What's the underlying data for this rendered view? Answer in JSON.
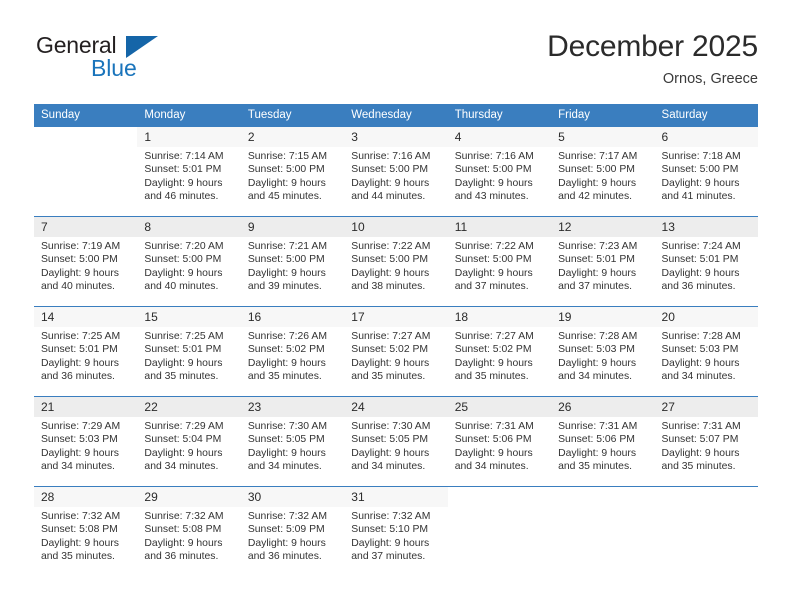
{
  "brand": {
    "name_part1": "General",
    "name_part2": "Blue",
    "accent_color": "#1a74bb",
    "triangle_color": "#1565a8",
    "logo_icon": "blue-triangle-icon"
  },
  "header": {
    "title": "December 2025",
    "subtitle": "Ornos, Greece"
  },
  "calendar": {
    "header_bg": "#3a7ebf",
    "weekday_headers": [
      "Sunday",
      "Monday",
      "Tuesday",
      "Wednesday",
      "Thursday",
      "Friday",
      "Saturday"
    ],
    "weeks": [
      [
        {
          "day": ""
        },
        {
          "day": "1",
          "sunrise": "Sunrise: 7:14 AM",
          "sunset": "Sunset: 5:01 PM",
          "daylight1": "Daylight: 9 hours",
          "daylight2": "and 46 minutes."
        },
        {
          "day": "2",
          "sunrise": "Sunrise: 7:15 AM",
          "sunset": "Sunset: 5:00 PM",
          "daylight1": "Daylight: 9 hours",
          "daylight2": "and 45 minutes."
        },
        {
          "day": "3",
          "sunrise": "Sunrise: 7:16 AM",
          "sunset": "Sunset: 5:00 PM",
          "daylight1": "Daylight: 9 hours",
          "daylight2": "and 44 minutes."
        },
        {
          "day": "4",
          "sunrise": "Sunrise: 7:16 AM",
          "sunset": "Sunset: 5:00 PM",
          "daylight1": "Daylight: 9 hours",
          "daylight2": "and 43 minutes."
        },
        {
          "day": "5",
          "sunrise": "Sunrise: 7:17 AM",
          "sunset": "Sunset: 5:00 PM",
          "daylight1": "Daylight: 9 hours",
          "daylight2": "and 42 minutes."
        },
        {
          "day": "6",
          "sunrise": "Sunrise: 7:18 AM",
          "sunset": "Sunset: 5:00 PM",
          "daylight1": "Daylight: 9 hours",
          "daylight2": "and 41 minutes."
        }
      ],
      [
        {
          "day": "7",
          "sunrise": "Sunrise: 7:19 AM",
          "sunset": "Sunset: 5:00 PM",
          "daylight1": "Daylight: 9 hours",
          "daylight2": "and 40 minutes."
        },
        {
          "day": "8",
          "sunrise": "Sunrise: 7:20 AM",
          "sunset": "Sunset: 5:00 PM",
          "daylight1": "Daylight: 9 hours",
          "daylight2": "and 40 minutes."
        },
        {
          "day": "9",
          "sunrise": "Sunrise: 7:21 AM",
          "sunset": "Sunset: 5:00 PM",
          "daylight1": "Daylight: 9 hours",
          "daylight2": "and 39 minutes."
        },
        {
          "day": "10",
          "sunrise": "Sunrise: 7:22 AM",
          "sunset": "Sunset: 5:00 PM",
          "daylight1": "Daylight: 9 hours",
          "daylight2": "and 38 minutes."
        },
        {
          "day": "11",
          "sunrise": "Sunrise: 7:22 AM",
          "sunset": "Sunset: 5:00 PM",
          "daylight1": "Daylight: 9 hours",
          "daylight2": "and 37 minutes."
        },
        {
          "day": "12",
          "sunrise": "Sunrise: 7:23 AM",
          "sunset": "Sunset: 5:01 PM",
          "daylight1": "Daylight: 9 hours",
          "daylight2": "and 37 minutes."
        },
        {
          "day": "13",
          "sunrise": "Sunrise: 7:24 AM",
          "sunset": "Sunset: 5:01 PM",
          "daylight1": "Daylight: 9 hours",
          "daylight2": "and 36 minutes."
        }
      ],
      [
        {
          "day": "14",
          "sunrise": "Sunrise: 7:25 AM",
          "sunset": "Sunset: 5:01 PM",
          "daylight1": "Daylight: 9 hours",
          "daylight2": "and 36 minutes."
        },
        {
          "day": "15",
          "sunrise": "Sunrise: 7:25 AM",
          "sunset": "Sunset: 5:01 PM",
          "daylight1": "Daylight: 9 hours",
          "daylight2": "and 35 minutes."
        },
        {
          "day": "16",
          "sunrise": "Sunrise: 7:26 AM",
          "sunset": "Sunset: 5:02 PM",
          "daylight1": "Daylight: 9 hours",
          "daylight2": "and 35 minutes."
        },
        {
          "day": "17",
          "sunrise": "Sunrise: 7:27 AM",
          "sunset": "Sunset: 5:02 PM",
          "daylight1": "Daylight: 9 hours",
          "daylight2": "and 35 minutes."
        },
        {
          "day": "18",
          "sunrise": "Sunrise: 7:27 AM",
          "sunset": "Sunset: 5:02 PM",
          "daylight1": "Daylight: 9 hours",
          "daylight2": "and 35 minutes."
        },
        {
          "day": "19",
          "sunrise": "Sunrise: 7:28 AM",
          "sunset": "Sunset: 5:03 PM",
          "daylight1": "Daylight: 9 hours",
          "daylight2": "and 34 minutes."
        },
        {
          "day": "20",
          "sunrise": "Sunrise: 7:28 AM",
          "sunset": "Sunset: 5:03 PM",
          "daylight1": "Daylight: 9 hours",
          "daylight2": "and 34 minutes."
        }
      ],
      [
        {
          "day": "21",
          "sunrise": "Sunrise: 7:29 AM",
          "sunset": "Sunset: 5:03 PM",
          "daylight1": "Daylight: 9 hours",
          "daylight2": "and 34 minutes."
        },
        {
          "day": "22",
          "sunrise": "Sunrise: 7:29 AM",
          "sunset": "Sunset: 5:04 PM",
          "daylight1": "Daylight: 9 hours",
          "daylight2": "and 34 minutes."
        },
        {
          "day": "23",
          "sunrise": "Sunrise: 7:30 AM",
          "sunset": "Sunset: 5:05 PM",
          "daylight1": "Daylight: 9 hours",
          "daylight2": "and 34 minutes."
        },
        {
          "day": "24",
          "sunrise": "Sunrise: 7:30 AM",
          "sunset": "Sunset: 5:05 PM",
          "daylight1": "Daylight: 9 hours",
          "daylight2": "and 34 minutes."
        },
        {
          "day": "25",
          "sunrise": "Sunrise: 7:31 AM",
          "sunset": "Sunset: 5:06 PM",
          "daylight1": "Daylight: 9 hours",
          "daylight2": "and 34 minutes."
        },
        {
          "day": "26",
          "sunrise": "Sunrise: 7:31 AM",
          "sunset": "Sunset: 5:06 PM",
          "daylight1": "Daylight: 9 hours",
          "daylight2": "and 35 minutes."
        },
        {
          "day": "27",
          "sunrise": "Sunrise: 7:31 AM",
          "sunset": "Sunset: 5:07 PM",
          "daylight1": "Daylight: 9 hours",
          "daylight2": "and 35 minutes."
        }
      ],
      [
        {
          "day": "28",
          "sunrise": "Sunrise: 7:32 AM",
          "sunset": "Sunset: 5:08 PM",
          "daylight1": "Daylight: 9 hours",
          "daylight2": "and 35 minutes."
        },
        {
          "day": "29",
          "sunrise": "Sunrise: 7:32 AM",
          "sunset": "Sunset: 5:08 PM",
          "daylight1": "Daylight: 9 hours",
          "daylight2": "and 36 minutes."
        },
        {
          "day": "30",
          "sunrise": "Sunrise: 7:32 AM",
          "sunset": "Sunset: 5:09 PM",
          "daylight1": "Daylight: 9 hours",
          "daylight2": "and 36 minutes."
        },
        {
          "day": "31",
          "sunrise": "Sunrise: 7:32 AM",
          "sunset": "Sunset: 5:10 PM",
          "daylight1": "Daylight: 9 hours",
          "daylight2": "and 37 minutes."
        },
        {
          "day": ""
        },
        {
          "day": ""
        },
        {
          "day": ""
        }
      ]
    ]
  }
}
